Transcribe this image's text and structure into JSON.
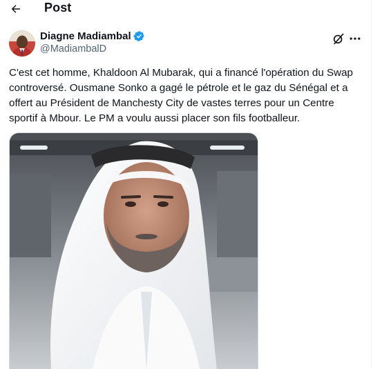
{
  "topbar": {
    "title": "Post",
    "back_icon": "arrow-left-icon"
  },
  "author": {
    "display_name": "Diagne Madiambal",
    "handle": "@MadiambalD",
    "verified": true,
    "verified_color": "#1d9bf0"
  },
  "actions": {
    "grok_icon": "grok-icon",
    "more_icon": "more-horizontal-icon"
  },
  "tweet": {
    "text": "C'est cet homme, Khaldoon Al Mubarak, qui a financé l'opération du Swap controversé. Ousmane Sonko a gagé le pétrole et le gaz du Sénégal et a offert au Président de Manchesty City de vastes terres pour un Centre sportif à Mbour. Le PM a voulu aussi placer son fils footballeur."
  },
  "colors": {
    "text": "#0f1419",
    "secondary": "#536471",
    "border": "#eff3f4"
  }
}
